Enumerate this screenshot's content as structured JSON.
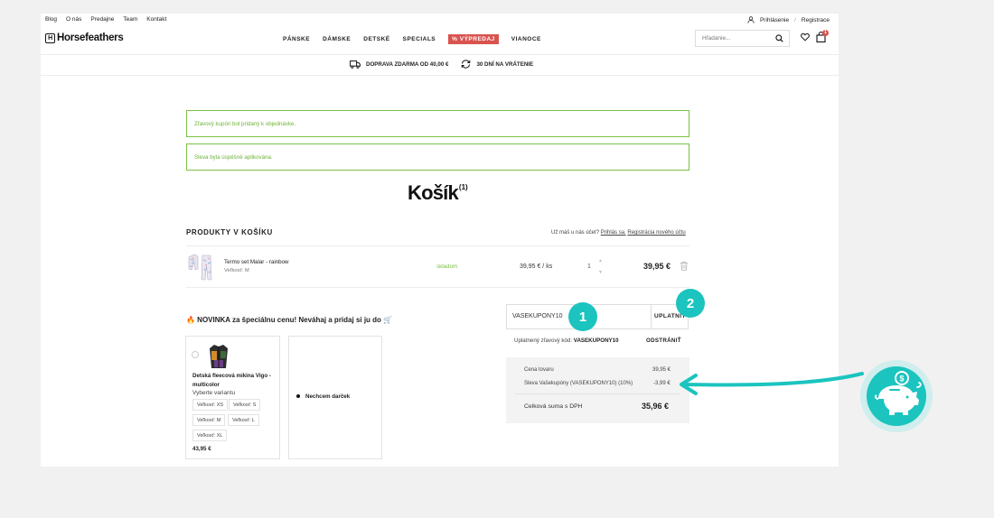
{
  "top_links": [
    "Blog",
    "O nás",
    "Predajne",
    "Team",
    "Kontakt"
  ],
  "account": {
    "login": "Prihlásenie",
    "separator": "/",
    "register": "Registrace"
  },
  "brand": {
    "name": "Horsefeathers",
    "mark": "H"
  },
  "nav": [
    "PÁNSKE",
    "DÁMSKE",
    "DETSKÉ",
    "SPECIALS",
    "% VÝPREDAJ",
    "VIANOCE"
  ],
  "search": {
    "placeholder": "Hľadanie..."
  },
  "cart_count": "1",
  "shipping": {
    "free": "DOPRAVA ZDARMA OD 40,00 €",
    "returns": "30 DNÍ NA VRÁTENIE"
  },
  "alerts": [
    "Zľavový kupón bol pridaný k objednávke.",
    "Sleva byla úspěšně aplikována."
  ],
  "page_title": "Košík",
  "page_title_count": "(1)",
  "products_heading": "PRODUKTY V KOŠÍKU",
  "login_prompt": {
    "text": "Už máš u nás účet?",
    "login": "Prihlás sa.",
    "register": "Registrácia nového účtu"
  },
  "cart_item": {
    "name": "Termo set Malar - rainbow",
    "size": "Veľkosť: M",
    "stock": "skladom",
    "unit_price": "39,95 € / ks",
    "quantity": "1",
    "total": "39,95 €"
  },
  "promo": {
    "heading": "🔥 NOVINKA za špeciálnu cenu! Neváhaj a pridaj si ju do 🛒",
    "product_name": "Detská fleecová mikina Vigo - multicolor",
    "variant_label": "Vyberte variantu",
    "sizes": [
      "Veľkosť: XS",
      "Veľkosť: S",
      "Veľkosť: M",
      "Veľkosť: L",
      "Veľkosť: XL"
    ],
    "price": "43,95 €",
    "no_gift": "Nechcem darček"
  },
  "coupon": {
    "value": "VASEKUPONY10",
    "apply": "UPLATNIŤ",
    "applied_label": "Uplatnený zľavový kód:",
    "applied_code": "VASEKUPONY10",
    "remove": "ODSTRÁNIŤ"
  },
  "step_badges": [
    "1",
    "2"
  ],
  "summary": {
    "goods_label": "Cena tovaru",
    "goods_value": "39,95 €",
    "discount_label": "Sleva Vašekupóny (VASEKUPONY10) (10%)",
    "discount_value": "-3,99 €",
    "total_label": "Celková suma s DPH",
    "total_value": "35,96 €"
  },
  "colors": {
    "accent": "#1bc4bf",
    "success": "#7dc243",
    "sale": "#d9534f"
  }
}
